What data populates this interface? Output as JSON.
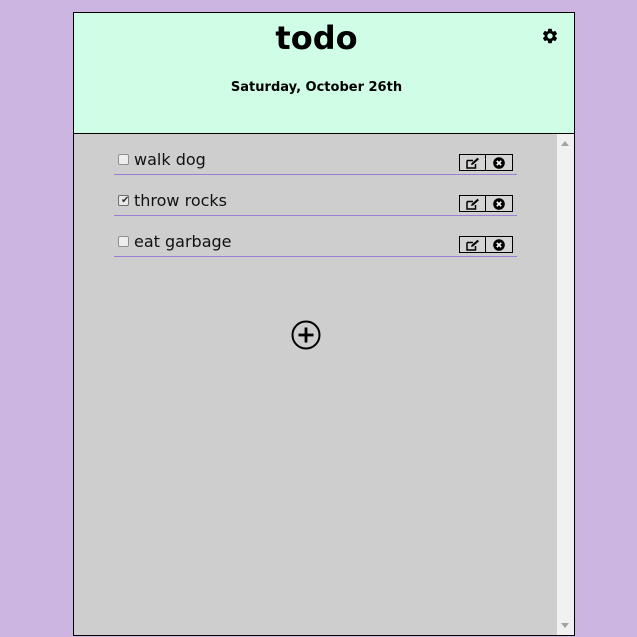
{
  "header": {
    "title": "todo",
    "date": "Saturday, October 26th",
    "background": "#d0fde6"
  },
  "settings": {
    "icon": "gear-icon"
  },
  "todos": [
    {
      "label": "walk dog",
      "checked": false
    },
    {
      "label": "throw rocks",
      "checked": true
    },
    {
      "label": "eat garbage",
      "checked": false
    }
  ],
  "item_actions": {
    "edit_icon": "edit-icon",
    "delete_icon": "delete-x-circle-icon"
  },
  "add_button": {
    "icon": "plus-circle-icon"
  },
  "colors": {
    "page_background": "#cdb5e2",
    "list_background": "#cecece",
    "divider": "#9b7fd4"
  }
}
